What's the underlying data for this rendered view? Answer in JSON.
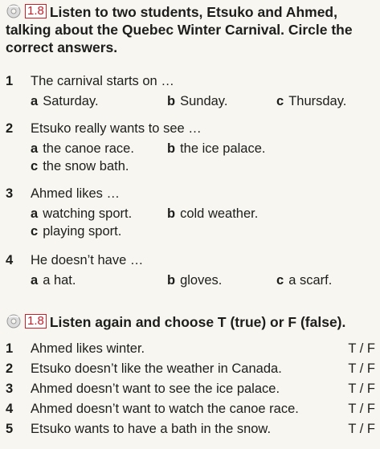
{
  "section1": {
    "track": "1.8",
    "instruction": "Listen to two students, Etsuko and Ahmed, talking about the Quebec Winter Carnival. Circle the correct answers.",
    "questions": [
      {
        "num": "1",
        "text": "The carnival starts on …",
        "options": [
          {
            "letter": "a",
            "text": "Saturday."
          },
          {
            "letter": "b",
            "text": "Sunday."
          },
          {
            "letter": "c",
            "text": "Thursday."
          }
        ]
      },
      {
        "num": "2",
        "text": "Etsuko really wants to see …",
        "options": [
          {
            "letter": "a",
            "text": "the canoe race."
          },
          {
            "letter": "b",
            "text": "the ice palace."
          },
          {
            "letter": "c",
            "text": "the snow bath."
          }
        ]
      },
      {
        "num": "3",
        "text": "Ahmed likes …",
        "options": [
          {
            "letter": "a",
            "text": "watching sport."
          },
          {
            "letter": "b",
            "text": "cold weather."
          },
          {
            "letter": "c",
            "text": "playing sport."
          }
        ]
      },
      {
        "num": "4",
        "text": "He doesn’t have …",
        "options": [
          {
            "letter": "a",
            "text": "a hat."
          },
          {
            "letter": "b",
            "text": "gloves."
          },
          {
            "letter": "c",
            "text": "a scarf."
          }
        ]
      }
    ]
  },
  "section2": {
    "track": "1.8",
    "instruction": "Listen again and choose T (true) or F (false).",
    "items": [
      {
        "num": "1",
        "text": "Ahmed likes winter.",
        "mark": "T / F"
      },
      {
        "num": "2",
        "text": "Etsuko doesn’t like the weather in Canada.",
        "mark": "T / F"
      },
      {
        "num": "3",
        "text": "Ahmed doesn’t want to see the ice palace.",
        "mark": "T / F"
      },
      {
        "num": "4",
        "text": "Ahmed doesn’t want to watch the canoe race.",
        "mark": "T / F"
      },
      {
        "num": "5",
        "text": "Etsuko wants to have a bath in the snow.",
        "mark": "T / F"
      }
    ]
  }
}
